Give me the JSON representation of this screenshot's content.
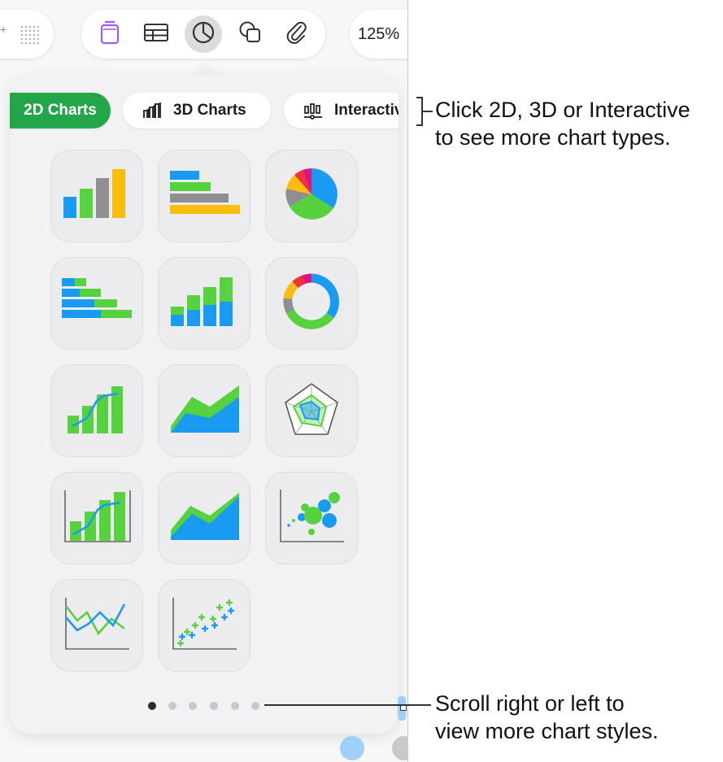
{
  "toolbar": {
    "zoom": "125%",
    "tools": [
      {
        "name": "text-tool",
        "icon": "text-box-icon"
      },
      {
        "name": "table-tool",
        "icon": "table-icon"
      },
      {
        "name": "chart-tool",
        "icon": "pie-chart-icon",
        "active": true
      },
      {
        "name": "shape-tool",
        "icon": "shapes-icon"
      },
      {
        "name": "media-tool",
        "icon": "paperclip-icon"
      }
    ]
  },
  "chart_picker": {
    "tabs": [
      {
        "label": "2D Charts",
        "selected": true,
        "color": "#23a54a"
      },
      {
        "label": "3D Charts",
        "selected": false,
        "icon": "3d-bar-icon"
      },
      {
        "label": "Interactive",
        "selected": false,
        "icon": "interactive-chart-icon"
      }
    ],
    "chart_types": [
      "column",
      "bar",
      "pie",
      "stacked-bar",
      "stacked-column",
      "donut",
      "mixed",
      "area",
      "radar",
      "two-axis",
      "stacked-area",
      "bubble",
      "line",
      "scatter"
    ],
    "pages": 6,
    "current_page": 1
  },
  "colors": {
    "blue": "#1a9bf2",
    "green": "#55d23d",
    "gray": "#8e8e93",
    "yellow": "#fbbd0b",
    "red": "#f2323a",
    "magenta": "#e3127a",
    "accent": "#23a54a"
  },
  "callouts": {
    "tabs_line1": "Click 2D, 3D or Interactive",
    "tabs_line2": "to see more chart types.",
    "scroll_line1": "Scroll right or left to",
    "scroll_line2": "view more chart styles."
  }
}
